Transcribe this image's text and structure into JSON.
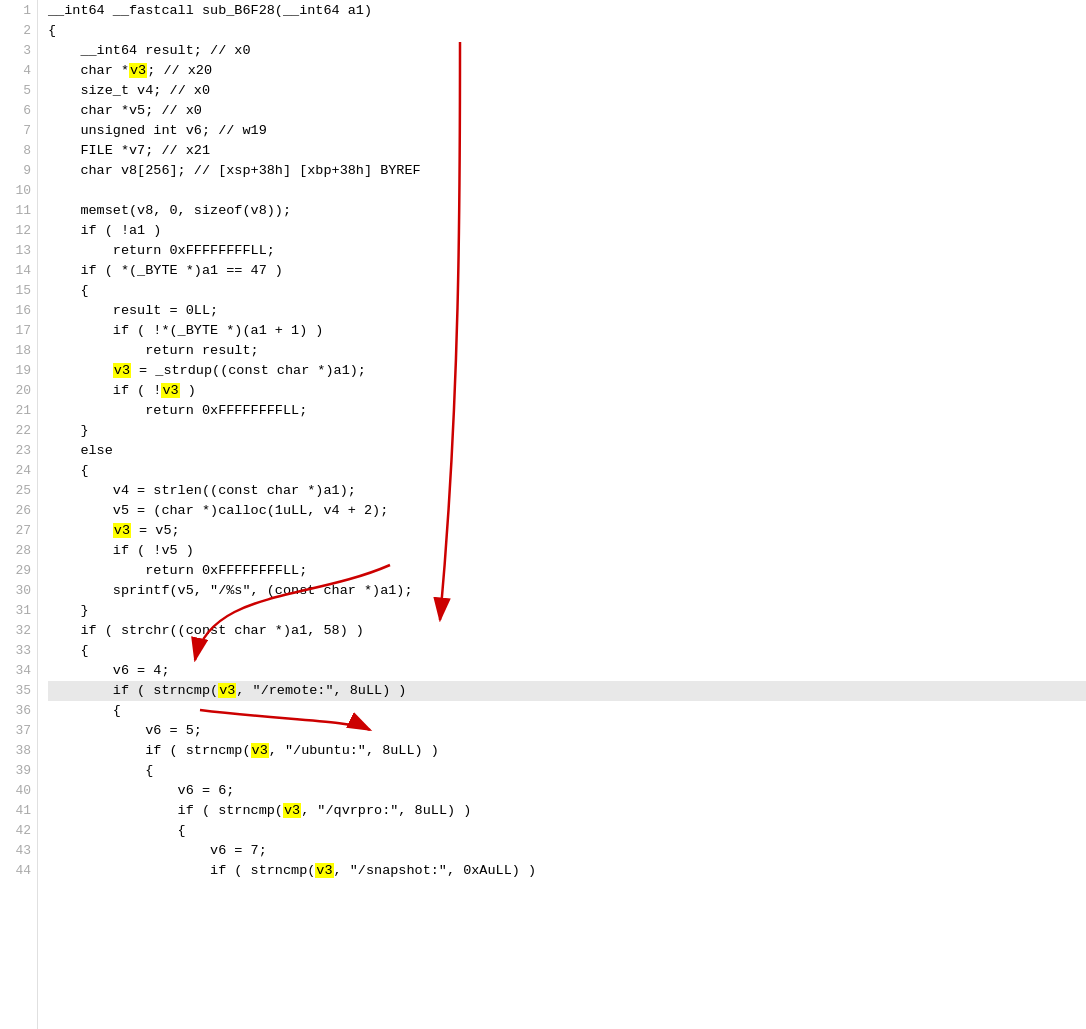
{
  "lines": [
    {
      "num": 1,
      "dot": false,
      "highlight": false,
      "tokens": [
        {
          "t": "__int64 __fastcall sub_B6F28(__int64 a1)",
          "c": "plain"
        }
      ]
    },
    {
      "num": 2,
      "dot": false,
      "highlight": false,
      "tokens": [
        {
          "t": "{",
          "c": "plain"
        }
      ]
    },
    {
      "num": 3,
      "dot": false,
      "highlight": false,
      "tokens": [
        {
          "t": "    __int64 result; ",
          "c": "plain"
        },
        {
          "t": "// x0",
          "c": "comment"
        }
      ]
    },
    {
      "num": 4,
      "dot": false,
      "highlight": false,
      "tokens": [
        {
          "t": "    char *",
          "c": "plain"
        },
        {
          "t": "v3",
          "c": "hl-var"
        },
        {
          "t": "; ",
          "c": "plain"
        },
        {
          "t": "// x20",
          "c": "comment"
        }
      ]
    },
    {
      "num": 5,
      "dot": false,
      "highlight": false,
      "tokens": [
        {
          "t": "    size_t v4; ",
          "c": "plain"
        },
        {
          "t": "// x0",
          "c": "comment"
        }
      ]
    },
    {
      "num": 6,
      "dot": false,
      "highlight": false,
      "tokens": [
        {
          "t": "    char *v5; ",
          "c": "plain"
        },
        {
          "t": "// x0",
          "c": "comment"
        }
      ]
    },
    {
      "num": 7,
      "dot": false,
      "highlight": false,
      "tokens": [
        {
          "t": "    unsigned int v6; ",
          "c": "plain"
        },
        {
          "t": "// w19",
          "c": "comment"
        }
      ]
    },
    {
      "num": 8,
      "dot": false,
      "highlight": false,
      "tokens": [
        {
          "t": "    FILE *v7; ",
          "c": "plain"
        },
        {
          "t": "// x21",
          "c": "comment"
        }
      ]
    },
    {
      "num": 9,
      "dot": false,
      "highlight": false,
      "tokens": [
        {
          "t": "    char v8[256]; ",
          "c": "plain"
        },
        {
          "t": "// [xsp+38h] [xbp+38h] BYREF",
          "c": "comment"
        }
      ]
    },
    {
      "num": 10,
      "dot": false,
      "highlight": false,
      "tokens": [
        {
          "t": "",
          "c": "plain"
        }
      ]
    },
    {
      "num": 11,
      "dot": true,
      "highlight": false,
      "tokens": [
        {
          "t": "    memset(v8, 0, sizeof(v8));",
          "c": "plain"
        }
      ]
    },
    {
      "num": 12,
      "dot": false,
      "highlight": false,
      "tokens": [
        {
          "t": "    if ( !a1 )",
          "c": "plain"
        }
      ]
    },
    {
      "num": 13,
      "dot": true,
      "highlight": false,
      "tokens": [
        {
          "t": "        return 0xFFFFFFFFLL;",
          "c": "plain"
        }
      ]
    },
    {
      "num": 14,
      "dot": false,
      "highlight": false,
      "tokens": [
        {
          "t": "    if ( *(_BYTE *)a1 == 47 )",
          "c": "plain"
        }
      ]
    },
    {
      "num": 15,
      "dot": false,
      "highlight": false,
      "tokens": [
        {
          "t": "    {",
          "c": "plain"
        }
      ]
    },
    {
      "num": 16,
      "dot": true,
      "highlight": false,
      "tokens": [
        {
          "t": "        result = 0LL;",
          "c": "plain"
        }
      ]
    },
    {
      "num": 17,
      "dot": false,
      "highlight": false,
      "tokens": [
        {
          "t": "        if ( !*(_BYTE *)(a1 + 1) )",
          "c": "plain"
        }
      ]
    },
    {
      "num": 18,
      "dot": true,
      "highlight": false,
      "tokens": [
        {
          "t": "            return result;",
          "c": "plain"
        }
      ]
    },
    {
      "num": 19,
      "dot": false,
      "highlight": false,
      "tokens": [
        {
          "t": "        ",
          "c": "plain"
        },
        {
          "t": "v3",
          "c": "hl-var"
        },
        {
          "t": " = _strdup((const char *)a1);",
          "c": "plain"
        }
      ]
    },
    {
      "num": 20,
      "dot": false,
      "highlight": false,
      "tokens": [
        {
          "t": "        if ( !",
          "c": "plain"
        },
        {
          "t": "v3",
          "c": "hl-var"
        },
        {
          "t": " )",
          "c": "plain"
        }
      ]
    },
    {
      "num": 21,
      "dot": true,
      "highlight": false,
      "tokens": [
        {
          "t": "            return 0xFFFFFFFFLL;",
          "c": "plain"
        }
      ]
    },
    {
      "num": 22,
      "dot": false,
      "highlight": false,
      "tokens": [
        {
          "t": "    }",
          "c": "plain"
        }
      ]
    },
    {
      "num": 23,
      "dot": false,
      "highlight": false,
      "tokens": [
        {
          "t": "    else",
          "c": "plain"
        }
      ]
    },
    {
      "num": 24,
      "dot": false,
      "highlight": false,
      "tokens": [
        {
          "t": "    {",
          "c": "plain"
        }
      ]
    },
    {
      "num": 25,
      "dot": true,
      "highlight": false,
      "tokens": [
        {
          "t": "        v4 = strlen((const char *)a1);",
          "c": "plain"
        }
      ]
    },
    {
      "num": 26,
      "dot": true,
      "highlight": false,
      "tokens": [
        {
          "t": "        v5 = (char *)calloc(1uLL, v4 + 2);",
          "c": "plain"
        }
      ]
    },
    {
      "num": 27,
      "dot": false,
      "highlight": false,
      "tokens": [
        {
          "t": "        ",
          "c": "plain"
        },
        {
          "t": "v3",
          "c": "hl-var"
        },
        {
          "t": " = v5;",
          "c": "plain"
        }
      ]
    },
    {
      "num": 28,
      "dot": false,
      "highlight": false,
      "tokens": [
        {
          "t": "        if ( !v5 )",
          "c": "plain"
        }
      ]
    },
    {
      "num": 29,
      "dot": true,
      "highlight": false,
      "tokens": [
        {
          "t": "            return 0xFFFFFFFFLL;",
          "c": "plain"
        }
      ]
    },
    {
      "num": 30,
      "dot": true,
      "highlight": false,
      "tokens": [
        {
          "t": "        sprintf(v5, \"/%s\", (const char *)a1);",
          "c": "plain"
        }
      ]
    },
    {
      "num": 31,
      "dot": false,
      "highlight": false,
      "tokens": [
        {
          "t": "    }",
          "c": "plain"
        }
      ]
    },
    {
      "num": 32,
      "dot": false,
      "highlight": false,
      "tokens": [
        {
          "t": "    if ( strchr((const char *)a1, 58) )",
          "c": "plain"
        }
      ]
    },
    {
      "num": 33,
      "dot": false,
      "highlight": false,
      "tokens": [
        {
          "t": "    {",
          "c": "plain"
        }
      ]
    },
    {
      "num": 34,
      "dot": true,
      "highlight": false,
      "tokens": [
        {
          "t": "        v6 = 4;",
          "c": "plain"
        }
      ]
    },
    {
      "num": 35,
      "dot": false,
      "highlight": true,
      "tokens": [
        {
          "t": "        if ( strncmp(",
          "c": "plain"
        },
        {
          "t": "v3",
          "c": "hl-var"
        },
        {
          "t": ", \"/remote:\", 8uLL) )",
          "c": "plain"
        }
      ]
    },
    {
      "num": 36,
      "dot": false,
      "highlight": false,
      "tokens": [
        {
          "t": "        {",
          "c": "plain"
        }
      ]
    },
    {
      "num": 37,
      "dot": true,
      "highlight": false,
      "tokens": [
        {
          "t": "            v6 = 5;",
          "c": "plain"
        }
      ]
    },
    {
      "num": 38,
      "dot": false,
      "highlight": false,
      "tokens": [
        {
          "t": "            if ( strncmp(",
          "c": "plain"
        },
        {
          "t": "v3",
          "c": "hl-var"
        },
        {
          "t": ", \"/ubuntu:\", 8uLL) )",
          "c": "plain"
        }
      ]
    },
    {
      "num": 39,
      "dot": false,
      "highlight": false,
      "tokens": [
        {
          "t": "            {",
          "c": "plain"
        }
      ]
    },
    {
      "num": 40,
      "dot": true,
      "highlight": false,
      "tokens": [
        {
          "t": "                v6 = 6;",
          "c": "plain"
        }
      ]
    },
    {
      "num": 41,
      "dot": false,
      "highlight": false,
      "tokens": [
        {
          "t": "                if ( strncmp(",
          "c": "plain"
        },
        {
          "t": "v3",
          "c": "hl-var"
        },
        {
          "t": ", \"/qvrpro:\", 8uLL) )",
          "c": "plain"
        }
      ]
    },
    {
      "num": 42,
      "dot": false,
      "highlight": false,
      "tokens": [
        {
          "t": "                {",
          "c": "plain"
        }
      ]
    },
    {
      "num": 43,
      "dot": true,
      "highlight": false,
      "tokens": [
        {
          "t": "                    v6 = 7;",
          "c": "plain"
        }
      ]
    },
    {
      "num": 44,
      "dot": false,
      "highlight": false,
      "tokens": [
        {
          "t": "                    if ( strncmp(",
          "c": "plain"
        },
        {
          "t": "v3",
          "c": "hl-var"
        },
        {
          "t": ", \"/snapshot:\", 0xAuLL) )",
          "c": "plain"
        }
      ]
    }
  ]
}
